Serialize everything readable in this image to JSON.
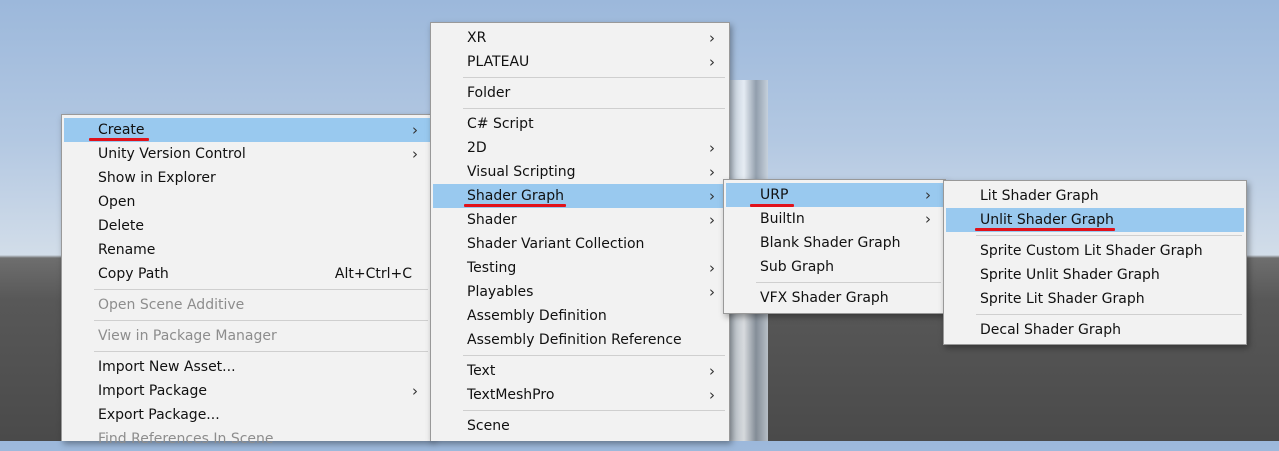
{
  "menus": {
    "main": [
      {
        "label": "Create",
        "arrow": "›",
        "highlighted": true
      },
      {
        "label": "Unity Version Control",
        "arrow": "›"
      },
      {
        "label": "Show in Explorer"
      },
      {
        "label": "Open"
      },
      {
        "label": "Delete"
      },
      {
        "label": "Rename"
      },
      {
        "label": "Copy Path",
        "shortcut": "Alt+Ctrl+C"
      },
      {
        "label": "Open Scene Additive",
        "disabled": true
      },
      {
        "label": "View in Package Manager",
        "disabled": true
      },
      {
        "label": "Import New Asset..."
      },
      {
        "label": "Import Package",
        "arrow": "›"
      },
      {
        "label": "Export Package..."
      },
      {
        "label": "Find References In Scene",
        "disabled": true
      }
    ],
    "create": [
      {
        "label": "XR",
        "arrow": "›"
      },
      {
        "label": "PLATEAU",
        "arrow": "›"
      },
      {
        "label": "Folder"
      },
      {
        "label": "C# Script"
      },
      {
        "label": "2D",
        "arrow": "›"
      },
      {
        "label": "Visual Scripting",
        "arrow": "›"
      },
      {
        "label": "Shader Graph",
        "arrow": "›",
        "highlighted": true
      },
      {
        "label": "Shader",
        "arrow": "›"
      },
      {
        "label": "Shader Variant Collection"
      },
      {
        "label": "Testing",
        "arrow": "›"
      },
      {
        "label": "Playables",
        "arrow": "›"
      },
      {
        "label": "Assembly Definition"
      },
      {
        "label": "Assembly Definition Reference"
      },
      {
        "label": "Text",
        "arrow": "›"
      },
      {
        "label": "TextMeshPro",
        "arrow": "›"
      },
      {
        "label": "Scene"
      }
    ],
    "shader_graph": [
      {
        "label": "URP",
        "arrow": "›",
        "highlighted": true
      },
      {
        "label": "BuiltIn",
        "arrow": "›"
      },
      {
        "label": "Blank Shader Graph"
      },
      {
        "label": "Sub Graph"
      },
      {
        "label": "VFX Shader Graph"
      }
    ],
    "urp": [
      {
        "label": "Lit Shader Graph"
      },
      {
        "label": "Unlit Shader Graph",
        "highlighted": true
      },
      {
        "label": "Sprite Custom Lit Shader Graph"
      },
      {
        "label": "Sprite Unlit Shader Graph"
      },
      {
        "label": "Sprite Lit Shader Graph"
      },
      {
        "label": "Decal Shader Graph"
      }
    ]
  },
  "colors": {
    "highlight": "#99c9ef",
    "annotation_underline": "#e0121b",
    "menu_background": "#f2f2f2"
  }
}
